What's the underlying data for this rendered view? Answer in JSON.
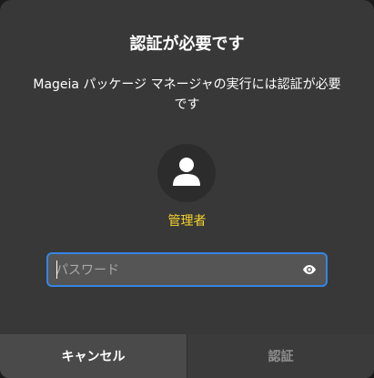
{
  "dialog": {
    "title": "認証が必要です",
    "message": "Mageia パッケージ マネージャの実行には認証が必要です"
  },
  "user": {
    "avatar_icon": "user-icon",
    "name": "管理者"
  },
  "password": {
    "placeholder": "パスワード",
    "value": "",
    "reveal_icon": "eye-icon"
  },
  "buttons": {
    "cancel_label": "キャンセル",
    "authenticate_label": "認証"
  },
  "colors": {
    "accent": "#3584e4",
    "username": "#f6d32d",
    "dialog_bg": "#383838"
  }
}
